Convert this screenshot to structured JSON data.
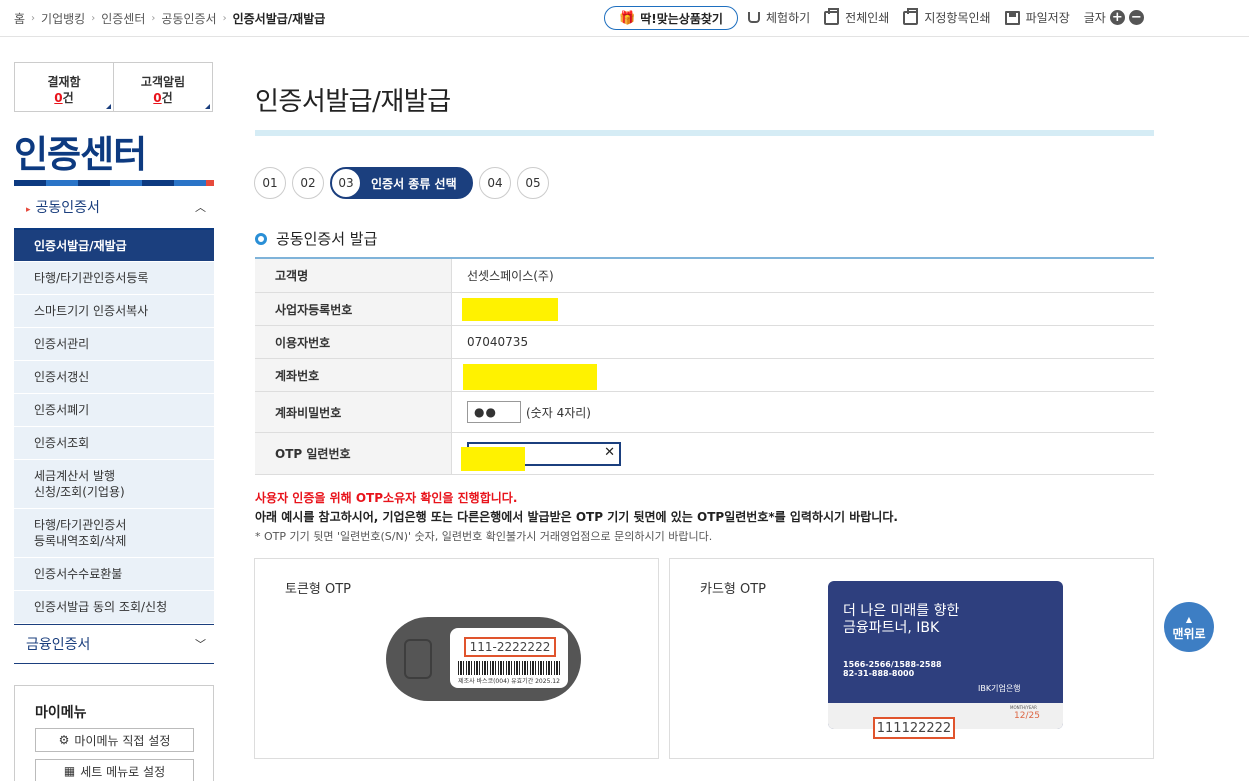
{
  "breadcrumb": [
    "홈",
    "기업뱅킹",
    "인증센터",
    "공동인증서",
    "인증서발급/재발급"
  ],
  "topbar": {
    "find_button": "딱!맞는상품찾기",
    "tools": [
      "체험하기",
      "전체인쇄",
      "지정항목인쇄",
      "파일저장"
    ],
    "font_label": "글자",
    "font_plus": "+",
    "font_minus": "−"
  },
  "sidebar": {
    "alerts": [
      {
        "label": "결재함",
        "count": "0",
        "unit": "건"
      },
      {
        "label": "고객알림",
        "count": "0",
        "unit": "건"
      }
    ],
    "title": "인증센터",
    "section1": "공동인증서",
    "items": [
      "인증서발급/재발급",
      "타행/타기관인증서등록",
      "스마트기기 인증서복사",
      "인증서관리",
      "인증서갱신",
      "인증서폐기",
      "인증서조회",
      "세금계산서 발행\n신청/조회(기업용)",
      "타행/타기관인증서\n등록내역조회/삭제",
      "인증서수수료환불",
      "인증서발급 동의 조회/신청"
    ],
    "section2": "금융인증서",
    "mymenu": {
      "title": "마이메뉴",
      "btn1": "마이메뉴 직접 설정",
      "btn2": "세트 메뉴로 설정"
    }
  },
  "main": {
    "title": "인증서발급/재발급",
    "steps": [
      "01",
      "02",
      "03",
      "04",
      "05"
    ],
    "active_step_label": "인증서 종류 선택",
    "section_title": "공동인증서 발급",
    "form": {
      "customer_label": "고객명",
      "customer_value": "선셋스페이스(주)",
      "bizno_label": "사업자등록번호",
      "userno_label": "이용자번호",
      "userno_value": "07040735",
      "account_label": "계좌번호",
      "pw_label": "계좌비밀번호",
      "pw_value": "●●",
      "pw_hint": "(숫자 4자리)",
      "otp_label": "OTP 일련번호"
    },
    "notice": {
      "red": "사용자 인증을 위해 OTP소유자 확인을 진행합니다.",
      "bold": "아래 예시를 참고하시어, 기업은행 또는 다른은행에서 발급받은 OTP 기기 뒷면에 있는 OTP일련번호*를 입력하시기 바랍니다.",
      "small": "* OTP 기기 뒷면 '일련번호(S/N)' 숫자, 일련번호 확인불가시 거래영업점으로 문의하시기 바랍니다."
    },
    "token_otp": {
      "title": "토큰형 OTP",
      "serial": "111-2222222",
      "caption": "제조사 바스코(004) 유효기간 2025.12"
    },
    "card_otp": {
      "title": "카드형 OTP",
      "headline1": "더 나은 미래를 향한",
      "headline2": "금융파트너, IBK",
      "phone1": "1566-2566/1588-2588",
      "phone2": "82-31-888-8000",
      "brand": "IBK기업은행",
      "month_year": "MONTH/YEAR",
      "expiry": "12/25",
      "serial": "111122222"
    },
    "top_button": "맨위로"
  }
}
